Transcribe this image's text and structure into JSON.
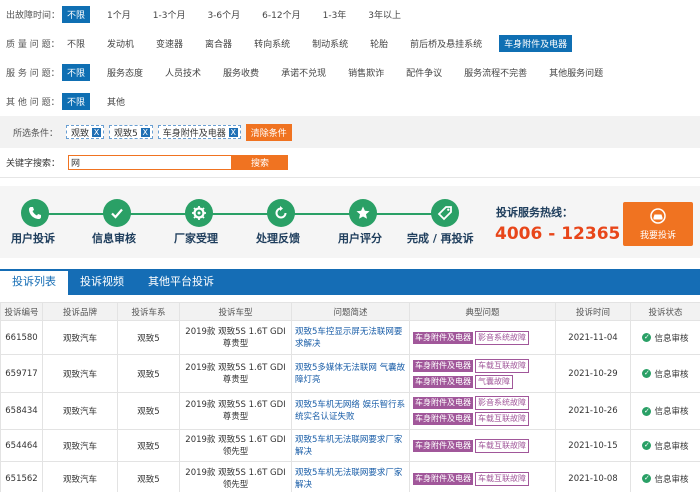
{
  "filters": {
    "time": {
      "label": "出故障时间：",
      "options": [
        "不限",
        "1个月",
        "1-3个月",
        "3-6个月",
        "6-12个月",
        "1-3年",
        "3年以上"
      ],
      "active": 0
    },
    "quality": {
      "label": "质 量 问 题：",
      "options": [
        "不限",
        "发动机",
        "变速器",
        "离合器",
        "转向系统",
        "制动系统",
        "轮胎",
        "前后桥及悬挂系统",
        "车身附件及电器"
      ],
      "active": 8
    },
    "service": {
      "label": "服 务 问 题：",
      "options": [
        "不限",
        "服务态度",
        "人员技术",
        "服务收费",
        "承诺不兑现",
        "销售欺诈",
        "配件争议",
        "服务流程不完善",
        "其他服务问题"
      ],
      "active": 0
    },
    "other": {
      "label": "其 他 问 题：",
      "options": [
        "不限",
        "其他"
      ],
      "active": 0
    }
  },
  "selected": {
    "label": "所选条件：",
    "tags": [
      "观致",
      "观致5",
      "车身附件及电器"
    ],
    "tag_close": "X",
    "clear_label": "清除条件"
  },
  "keyword": {
    "label": "关键字搜索：",
    "value": "网",
    "button": "搜索"
  },
  "process": {
    "steps": [
      "用户投诉",
      "信息审核",
      "厂家受理",
      "处理反馈",
      "用户评分",
      "完成 / 再投诉"
    ],
    "hotline_label": "投诉服务热线：",
    "hotline": "4006 - 12365 - 0",
    "complain_button": "我要投诉"
  },
  "tabs": [
    "投诉列表",
    "投诉视频",
    "其他平台投诉"
  ],
  "table": {
    "headers": [
      "投诉编号",
      "投诉品牌",
      "投诉车系",
      "投诉车型",
      "问题简述",
      "典型问题",
      "投诉时间",
      "投诉状态"
    ],
    "rows": [
      {
        "id": "661580",
        "brand": "观致汽车",
        "series": "观致5",
        "model": "2019款 观致5S 1.6T GDI 尊贵型",
        "desc": "观致5车控显示屏无法联网要求解决",
        "types": [
          "车身附件及电器",
          "影音系统故障"
        ],
        "date": "2021-11-04",
        "status": "信息审核"
      },
      {
        "id": "659717",
        "brand": "观致汽车",
        "series": "观致5",
        "model": "2019款 观致5S 1.6T GDI 尊贵型",
        "desc": "观致5多媒体无法联网 气囊故障灯亮",
        "types": [
          "车身附件及电器",
          "车载互联故障",
          "车身附件及电器",
          "气囊故障"
        ],
        "date": "2021-10-29",
        "status": "信息审核"
      },
      {
        "id": "658434",
        "brand": "观致汽车",
        "series": "观致5",
        "model": "2019款 观致5S 1.6T GDI 尊贵型",
        "desc": "观致5车机无网络 娱乐智行系统实名认证失败",
        "types": [
          "车身附件及电器",
          "影音系统故障",
          "车身附件及电器",
          "车载互联故障"
        ],
        "date": "2021-10-26",
        "status": "信息审核"
      },
      {
        "id": "654464",
        "brand": "观致汽车",
        "series": "观致5",
        "model": "2019款 观致5S 1.6T GDI 领先型",
        "desc": "观致5车机无法联网要求厂家解决",
        "types": [
          "车身附件及电器",
          "车载互联故障"
        ],
        "date": "2021-10-15",
        "status": "信息审核"
      },
      {
        "id": "651562",
        "brand": "观致汽车",
        "series": "观致5",
        "model": "2019款 观致5S 1.6T GDI 领先型",
        "desc": "观致5车机无法联网要求厂家解决",
        "types": [
          "车身附件及电器",
          "车载互联故障"
        ],
        "date": "2021-10-08",
        "status": "信息审核"
      }
    ]
  },
  "colors": {
    "accent": "#0f6fb3",
    "orange": "#f07321",
    "green": "#2aa066",
    "purple": "#a1579a",
    "hotline": "#e8461a"
  }
}
